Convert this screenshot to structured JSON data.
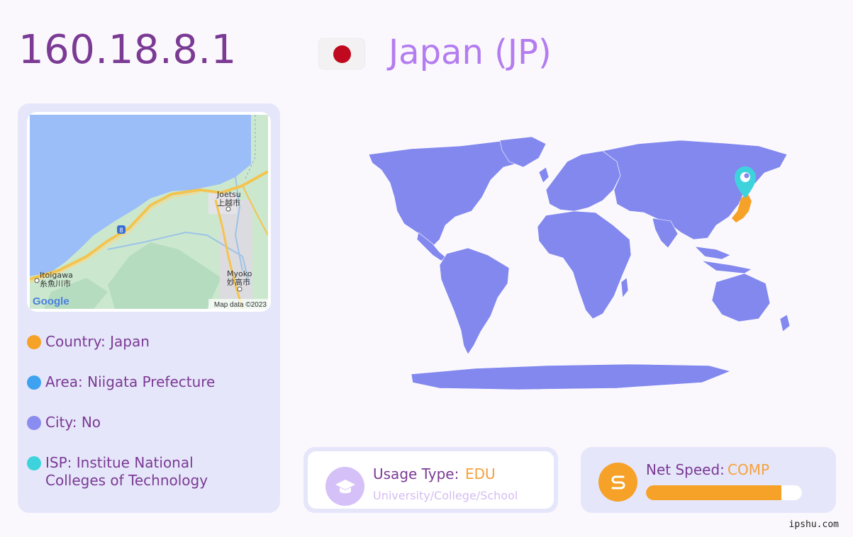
{
  "header": {
    "ip": "160.18.8.1",
    "country_title": "Japan (JP)"
  },
  "mini_map": {
    "labels": {
      "joetsu_en": "Joetsu",
      "joetsu_jp": "上越市",
      "itoigawa_en": "Itoigawa",
      "itoigawa_jp": "糸魚川市",
      "myoko_en": "Myoko",
      "myoko_jp": "妙高市",
      "route": "8",
      "google": "Google",
      "attribution": "Map data ©2023"
    }
  },
  "info": [
    {
      "text": "Country: Japan",
      "color": "#f6a127"
    },
    {
      "text": "Area: Niigata Prefecture",
      "color": "#3ea2f0"
    },
    {
      "text": "City: No",
      "color": "#8b8cf0"
    },
    {
      "text": "ISP: Institue National Colleges of Technology",
      "color": "#3ed3dc"
    }
  ],
  "usage": {
    "label": "Usage Type:",
    "value": "EDU",
    "sub": "University/College/School",
    "icon": "graduation-cap-icon"
  },
  "speed": {
    "label": "Net Speed:",
    "value": "COMP",
    "icon": "speed-s-icon",
    "level": 0.87
  },
  "watermark": "ipshu.com",
  "colors": {
    "accent": "#7b3a94",
    "land": "#8388ee",
    "highlight": "#f6a127",
    "pin": "#3ed3dc"
  }
}
